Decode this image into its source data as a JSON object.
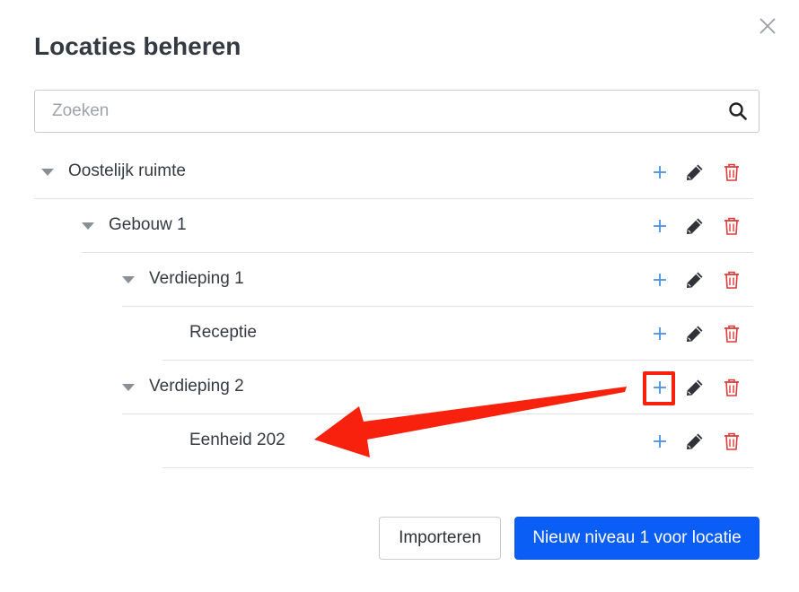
{
  "modal": {
    "title": "Locaties beheren",
    "close_icon": "close-icon"
  },
  "search": {
    "placeholder": "Zoeken",
    "value": "",
    "icon": "search-icon"
  },
  "tree": {
    "rows": [
      {
        "label": "Oostelijk ruimte",
        "level": 1,
        "expanded": true,
        "has_children": true
      },
      {
        "label": "Gebouw 1",
        "level": 2,
        "expanded": true,
        "has_children": true
      },
      {
        "label": "Verdieping 1",
        "level": 3,
        "expanded": true,
        "has_children": true
      },
      {
        "label": "Receptie",
        "level": 4,
        "expanded": false,
        "has_children": false
      },
      {
        "label": "Verdieping 2",
        "level": 3,
        "expanded": true,
        "has_children": true,
        "add_highlighted": true
      },
      {
        "label": "Eenheid 202",
        "level": 4,
        "expanded": false,
        "has_children": false
      }
    ],
    "action_icons": [
      "plus-icon",
      "pencil-icon",
      "trash-icon"
    ]
  },
  "footer": {
    "import_label": "Importeren",
    "new_label": "Nieuw niveau 1 voor locatie"
  },
  "colors": {
    "primary": "#0b5ef5",
    "add_icon": "#4a8fe0",
    "edit_icon": "#2f3338",
    "delete_icon": "#e03a3a",
    "annotation": "#f8210d"
  }
}
